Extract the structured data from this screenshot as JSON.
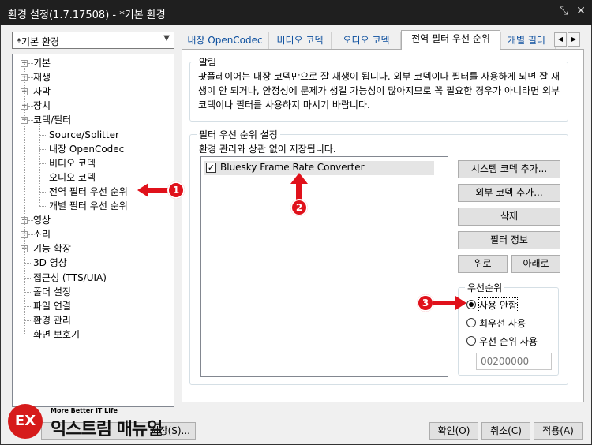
{
  "window": {
    "title": "환경 설정(1.7.17508) - *기본 환경",
    "pin_icon": "pin-icon",
    "close_icon": "close-icon"
  },
  "preset_combo": {
    "value": "*기본 환경"
  },
  "tree": {
    "items": [
      {
        "label": "기본",
        "expander": "+"
      },
      {
        "label": "재생",
        "expander": "+"
      },
      {
        "label": "자막",
        "expander": "+"
      },
      {
        "label": "장치",
        "expander": "+"
      },
      {
        "label": "코덱/필터",
        "expander": "−"
      },
      {
        "label": "Source/Splitter"
      },
      {
        "label": "내장 OpenCodec"
      },
      {
        "label": "비디오 코덱"
      },
      {
        "label": "오디오 코덱"
      },
      {
        "label": "전역 필터 우선 순위"
      },
      {
        "label": "개별 필터 우선 순위"
      },
      {
        "label": "영상",
        "expander": "+"
      },
      {
        "label": "소리",
        "expander": "+"
      },
      {
        "label": "기능 확장",
        "expander": "+"
      },
      {
        "label": "3D 영상"
      },
      {
        "label": "접근성 (TTS/UIA)"
      },
      {
        "label": "폴더 설정"
      },
      {
        "label": "파일 연결"
      },
      {
        "label": "환경 관리"
      },
      {
        "label": "화면 보호기"
      }
    ]
  },
  "tabs": [
    {
      "label": "내장 OpenCodec"
    },
    {
      "label": "비디오 코덱"
    },
    {
      "label": "오디오 코덱"
    },
    {
      "label": "전역 필터 우선 순위"
    },
    {
      "label": "개별 필터"
    }
  ],
  "notice": {
    "legend": "알림",
    "text": "팟플레이어는 내장 코덱만으로 잘 재생이 됩니다. 외부 코덱이나 필터를 사용하게 되면 잘 재생이 안 되거나, 안정성에 문제가 생길 가능성이 많아지므로 꼭 필요한 경우가 아니라면 외부 코덱이나 필터를 사용하지 마시기 바랍니다."
  },
  "filter_priority": {
    "legend": "필터 우선 순위 설정",
    "description": "환경 관리와 상관 없이 저장됩니다.",
    "items": [
      {
        "label": "Bluesky Frame Rate Converter",
        "checked": "✓"
      }
    ],
    "buttons": {
      "add_system": "시스템 코덱 추가...",
      "add_external": "외부 코덱 추가...",
      "delete": "삭제",
      "filter_info": "필터 정보",
      "up": "위로",
      "down": "아래로"
    },
    "priority": {
      "legend": "우선순위",
      "options": [
        "사용 안함",
        "최우선 사용",
        "우선 순위 사용"
      ],
      "selected": "사용 안함",
      "value": "00200000"
    }
  },
  "annotations": [
    "1",
    "2",
    "3"
  ],
  "footer": {
    "initialize_prefix": "",
    "save_label": "저장(S)...",
    "ok_label": "확인(O)",
    "cancel_label": "취소(C)",
    "apply_label": "적용(A)"
  },
  "watermark": {
    "mark": "EX",
    "sub": "More Better IT Life",
    "main": "익스트림 매뉴얼"
  },
  "colors": {
    "titlebar": "#1f1f1f",
    "annotation": "#e0111b",
    "tab_link": "#0b4e9e"
  }
}
